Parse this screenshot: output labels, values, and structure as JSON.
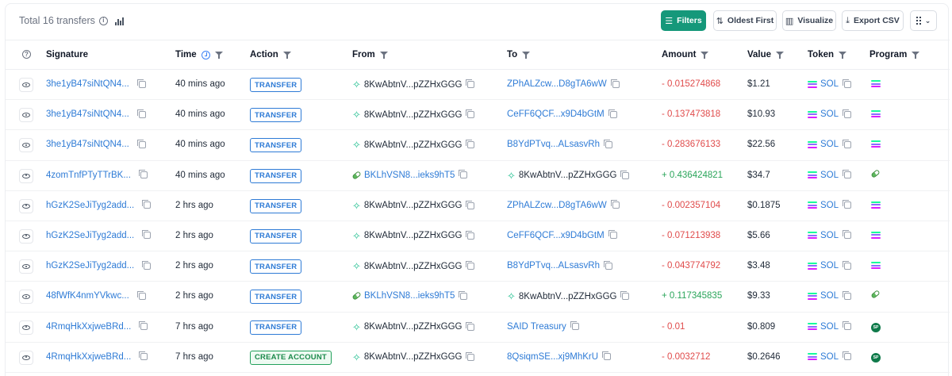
{
  "header": {
    "total_text": "Total 16 transfers",
    "buttons": {
      "filters": "Filters",
      "sort": "Oldest First",
      "visualize": "Visualize",
      "export": "Export CSV"
    }
  },
  "columns": {
    "signature": "Signature",
    "time": "Time",
    "action": "Action",
    "from": "From",
    "to": "To",
    "amount": "Amount",
    "value": "Value",
    "token": "Token",
    "program": "Program"
  },
  "rows": [
    {
      "signature": "3he1yB47siNtQN4...",
      "time": "40 mins ago",
      "action": "TRANSFER",
      "from": "8KwAbtnV...pZZHxGGG",
      "to": "ZPhALZcw...D8gTA6wW",
      "amount": "- 0.015274868",
      "value": "$1.21",
      "token": "SOL"
    },
    {
      "signature": "3he1yB47siNtQN4...",
      "time": "40 mins ago",
      "action": "TRANSFER",
      "from": "8KwAbtnV...pZZHxGGG",
      "to": "CeFF6QCF...x9D4bGtM",
      "amount": "- 0.137473818",
      "value": "$10.93",
      "token": "SOL"
    },
    {
      "signature": "3he1yB47siNtQN4...",
      "time": "40 mins ago",
      "action": "TRANSFER",
      "from": "8KwAbtnV...pZZHxGGG",
      "to": "B8YdPTvq...ALsasvRh",
      "amount": "- 0.283676133",
      "value": "$22.56",
      "token": "SOL"
    },
    {
      "signature": "4zomTnfPTyTTrBK...",
      "time": "40 mins ago",
      "action": "TRANSFER",
      "from": "BKLhVSN8...ieks9hT5",
      "to": "8KwAbtnV...pZZHxGGG",
      "amount": "+ 0.436424821",
      "value": "$34.7",
      "token": "SOL"
    },
    {
      "signature": "hGzK2SeJiTyg2add...",
      "time": "2 hrs ago",
      "action": "TRANSFER",
      "from": "8KwAbtnV...pZZHxGGG",
      "to": "ZPhALZcw...D8gTA6wW",
      "amount": "- 0.002357104",
      "value": "$0.1875",
      "token": "SOL"
    },
    {
      "signature": "hGzK2SeJiTyg2add...",
      "time": "2 hrs ago",
      "action": "TRANSFER",
      "from": "8KwAbtnV...pZZHxGGG",
      "to": "CeFF6QCF...x9D4bGtM",
      "amount": "- 0.071213938",
      "value": "$5.66",
      "token": "SOL"
    },
    {
      "signature": "hGzK2SeJiTyg2add...",
      "time": "2 hrs ago",
      "action": "TRANSFER",
      "from": "8KwAbtnV...pZZHxGGG",
      "to": "B8YdPTvq...ALsasvRh",
      "amount": "- 0.043774792",
      "value": "$3.48",
      "token": "SOL"
    },
    {
      "signature": "48fWfK4nmYVkwc...",
      "time": "2 hrs ago",
      "action": "TRANSFER",
      "from": "BKLhVSN8...ieks9hT5",
      "to": "8KwAbtnV...pZZHxGGG",
      "amount": "+ 0.117345835",
      "value": "$9.33",
      "token": "SOL"
    },
    {
      "signature": "4RmqHkXxjweBRd...",
      "time": "7 hrs ago",
      "action": "TRANSFER",
      "from": "8KwAbtnV...pZZHxGGG",
      "to": "SAID Treasury",
      "amount": "- 0.01",
      "value": "$0.809",
      "token": "SOL"
    },
    {
      "signature": "4RmqHkXxjweBRd...",
      "time": "7 hrs ago",
      "action": "CREATE ACCOUNT",
      "from": "8KwAbtnV...pZZHxGGG",
      "to": "8QsiqmSE...xj9MhKrU",
      "amount": "- 0.0032712",
      "value": "$0.2646",
      "token": "SOL"
    }
  ],
  "colors": {
    "accent": "#15987a",
    "link": "#2e7bd6",
    "negative": "#e04b4b",
    "positive": "#2aa55a"
  }
}
